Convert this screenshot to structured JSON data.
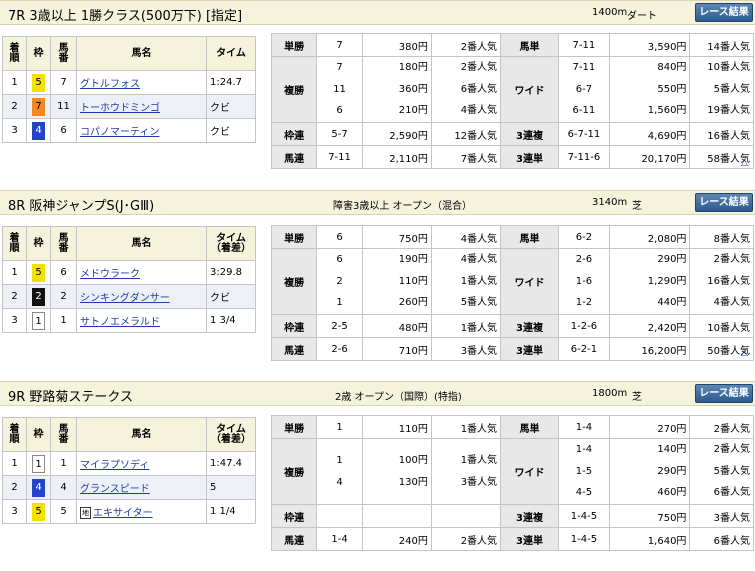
{
  "result_button_label": "レース結果",
  "up_arrow": "△",
  "result_headers": {
    "chaku": "着順",
    "waku": "枠",
    "umaban": "馬番",
    "name": "馬名",
    "time": "タイム",
    "time_sub": "（着差）"
  },
  "races": [
    {
      "title": "7R 3歳以上 1勝クラス(500万下) [指定]",
      "condition": "",
      "distance": "1400m",
      "surface": "ダート",
      "time_header_sub": false,
      "results": [
        {
          "place": "1",
          "frame": "5",
          "frame_color": "#f5e100",
          "frame_text": "#000",
          "num": "7",
          "name": "グトルフォス",
          "mark": "",
          "time": "1:24.7"
        },
        {
          "place": "2",
          "frame": "7",
          "frame_color": "#f08a1e",
          "frame_text": "#000",
          "num": "11",
          "name": "トーホウドミンゴ",
          "mark": "",
          "time": "クビ"
        },
        {
          "place": "3",
          "frame": "4",
          "frame_color": "#2244cc",
          "frame_text": "#fff",
          "num": "6",
          "name": "コパノマーティン",
          "mark": "",
          "time": "クビ"
        }
      ],
      "payouts": {
        "tansho": {
          "label": "単勝",
          "rows": [
            {
              "n": "7",
              "amt": "380円",
              "pop": "2番人気"
            }
          ]
        },
        "fukusho": {
          "label": "複勝",
          "rows": [
            {
              "n": "7",
              "amt": "180円",
              "pop": "2番人気"
            },
            {
              "n": "11",
              "amt": "360円",
              "pop": "6番人気"
            },
            {
              "n": "6",
              "amt": "210円",
              "pop": "4番人気"
            }
          ]
        },
        "wakuren": {
          "label": "枠連",
          "rows": [
            {
              "n": "5-7",
              "amt": "2,590円",
              "pop": "12番人気"
            }
          ]
        },
        "umaren": {
          "label": "馬連",
          "rows": [
            {
              "n": "7-11",
              "amt": "2,110円",
              "pop": "7番人気"
            }
          ]
        },
        "umatan": {
          "label": "馬単",
          "rows": [
            {
              "n": "7-11",
              "amt": "3,590円",
              "pop": "14番人気"
            }
          ]
        },
        "wide": {
          "label": "ワイド",
          "rows": [
            {
              "n": "7-11",
              "amt": "840円",
              "pop": "10番人気"
            },
            {
              "n": "6-7",
              "amt": "550円",
              "pop": "5番人気"
            },
            {
              "n": "6-11",
              "amt": "1,560円",
              "pop": "19番人気"
            }
          ]
        },
        "sanrenpuku": {
          "label": "3連複",
          "rows": [
            {
              "n": "6-7-11",
              "amt": "4,690円",
              "pop": "16番人気"
            }
          ]
        },
        "sanrentan": {
          "label": "3連単",
          "rows": [
            {
              "n": "7-11-6",
              "amt": "20,170円",
              "pop": "58番人気"
            }
          ]
        }
      }
    },
    {
      "title": "8R 阪神ジャンプS(J･GⅢ)",
      "condition": "障害3歳以上 オープン（混合）",
      "distance": "3140m",
      "surface": "芝",
      "time_header_sub": true,
      "results": [
        {
          "place": "1",
          "frame": "5",
          "frame_color": "#f5e100",
          "frame_text": "#000",
          "num": "6",
          "name": "メドウラーク",
          "mark": "",
          "time": "3:29.8"
        },
        {
          "place": "2",
          "frame": "2",
          "frame_color": "#111111",
          "frame_text": "#fff",
          "num": "2",
          "name": "シンキングダンサー",
          "mark": "",
          "time": "クビ"
        },
        {
          "place": "3",
          "frame": "1",
          "frame_color": "#ffffff",
          "frame_text": "#000",
          "num": "1",
          "name": "サトノエメラルド",
          "mark": "",
          "time": "1 3/4"
        }
      ],
      "payouts": {
        "tansho": {
          "label": "単勝",
          "rows": [
            {
              "n": "6",
              "amt": "750円",
              "pop": "4番人気"
            }
          ]
        },
        "fukusho": {
          "label": "複勝",
          "rows": [
            {
              "n": "6",
              "amt": "190円",
              "pop": "4番人気"
            },
            {
              "n": "2",
              "amt": "110円",
              "pop": "1番人気"
            },
            {
              "n": "1",
              "amt": "260円",
              "pop": "5番人気"
            }
          ]
        },
        "wakuren": {
          "label": "枠連",
          "rows": [
            {
              "n": "2-5",
              "amt": "480円",
              "pop": "1番人気"
            }
          ]
        },
        "umaren": {
          "label": "馬連",
          "rows": [
            {
              "n": "2-6",
              "amt": "710円",
              "pop": "3番人気"
            }
          ]
        },
        "umatan": {
          "label": "馬単",
          "rows": [
            {
              "n": "6-2",
              "amt": "2,080円",
              "pop": "8番人気"
            }
          ]
        },
        "wide": {
          "label": "ワイド",
          "rows": [
            {
              "n": "2-6",
              "amt": "290円",
              "pop": "2番人気"
            },
            {
              "n": "1-6",
              "amt": "1,290円",
              "pop": "16番人気"
            },
            {
              "n": "1-2",
              "amt": "440円",
              "pop": "4番人気"
            }
          ]
        },
        "sanrenpuku": {
          "label": "3連複",
          "rows": [
            {
              "n": "1-2-6",
              "amt": "2,420円",
              "pop": "10番人気"
            }
          ]
        },
        "sanrentan": {
          "label": "3連単",
          "rows": [
            {
              "n": "6-2-1",
              "amt": "16,200円",
              "pop": "50番人気"
            }
          ]
        }
      }
    },
    {
      "title": "9R 野路菊ステークス",
      "condition": "2歳 オープン（国際）(特指)",
      "distance": "1800m",
      "surface": "芝",
      "time_header_sub": true,
      "results": [
        {
          "place": "1",
          "frame": "1",
          "frame_color": "#ffffff",
          "frame_text": "#000",
          "num": "1",
          "name": "マイラプソディ",
          "mark": "",
          "time": "1:47.4"
        },
        {
          "place": "2",
          "frame": "4",
          "frame_color": "#2244cc",
          "frame_text": "#fff",
          "num": "4",
          "name": "グランスピード",
          "mark": "",
          "time": "5"
        },
        {
          "place": "3",
          "frame": "5",
          "frame_color": "#f5e100",
          "frame_text": "#000",
          "num": "5",
          "name": "エキサイター",
          "mark": "地",
          "time": "1 1/4"
        }
      ],
      "payouts": {
        "tansho": {
          "label": "単勝",
          "rows": [
            {
              "n": "1",
              "amt": "110円",
              "pop": "1番人気"
            }
          ]
        },
        "fukusho": {
          "label": "複勝",
          "rows": [
            {
              "n": "1",
              "amt": "100円",
              "pop": "1番人気"
            },
            {
              "n": "4",
              "amt": "130円",
              "pop": "3番人気"
            }
          ]
        },
        "wakuren": {
          "label": "枠連",
          "rows": [
            {
              "n": "",
              "amt": "",
              "pop": ""
            }
          ]
        },
        "umaren": {
          "label": "馬連",
          "rows": [
            {
              "n": "1-4",
              "amt": "240円",
              "pop": "2番人気"
            }
          ]
        },
        "umatan": {
          "label": "馬単",
          "rows": [
            {
              "n": "1-4",
              "amt": "270円",
              "pop": "2番人気"
            }
          ]
        },
        "wide": {
          "label": "ワイド",
          "rows": [
            {
              "n": "1-4",
              "amt": "140円",
              "pop": "2番人気"
            },
            {
              "n": "1-5",
              "amt": "290円",
              "pop": "5番人気"
            },
            {
              "n": "4-5",
              "amt": "460円",
              "pop": "6番人気"
            }
          ]
        },
        "sanrenpuku": {
          "label": "3連複",
          "rows": [
            {
              "n": "1-4-5",
              "amt": "750円",
              "pop": "3番人気"
            }
          ]
        },
        "sanrentan": {
          "label": "3連単",
          "rows": [
            {
              "n": "1-4-5",
              "amt": "1,640円",
              "pop": "6番人気"
            }
          ]
        }
      }
    }
  ]
}
